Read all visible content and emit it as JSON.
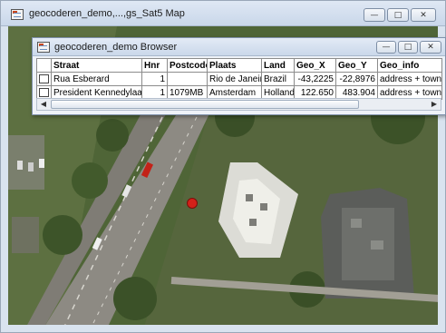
{
  "map_window": {
    "title": "geocoderen_demo,...,gs_Sat5 Map",
    "buttons": {
      "minimize": "—",
      "maximize": "□",
      "close": "✕"
    }
  },
  "browser_window": {
    "title": "geocoderen_demo Browser",
    "buttons": {
      "minimize": "—",
      "maximize": "□",
      "close": "✕"
    },
    "columns": [
      "Straat",
      "Hnr",
      "Postcode",
      "Plaats",
      "Land",
      "Geo_X",
      "Geo_Y",
      "Geo_info"
    ],
    "rows": [
      [
        "Rua Esberard",
        "1",
        "",
        "Rio de Janeiro",
        "Brazil",
        "-43,2225",
        "-22,8976",
        "address + town"
      ],
      [
        "President Kennedylaan",
        "1",
        "1079MB",
        "Amsterdam",
        "Holland",
        "122.650",
        "483.904",
        "address + town"
      ]
    ],
    "scrollbar": {
      "left_arrow": "◀",
      "right_arrow": "▶"
    }
  },
  "icons": [
    "app-window-icon",
    "map-marker-icon"
  ],
  "colors": {
    "marker": "#d32119",
    "vegetation": "#4e6336",
    "road": "#8d8a83"
  }
}
